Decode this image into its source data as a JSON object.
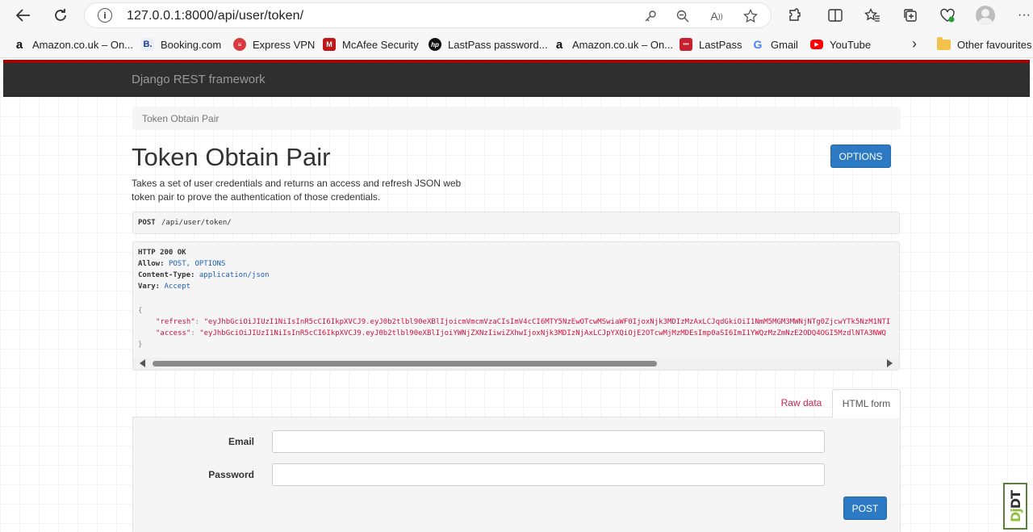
{
  "browser": {
    "url": "127.0.0.1:8000/api/user/token/",
    "bookmarks": [
      {
        "label": "Amazon.co.uk – On...",
        "icon": "amazon-icon"
      },
      {
        "label": "Booking.com",
        "icon": "booking-icon"
      },
      {
        "label": "Express VPN",
        "icon": "expressvpn-icon"
      },
      {
        "label": "McAfee Security",
        "icon": "mcafee-icon"
      },
      {
        "label": "LastPass password...",
        "icon": "hp-icon"
      },
      {
        "label": "Amazon.co.uk – On...",
        "icon": "amazon-icon"
      },
      {
        "label": "LastPass",
        "icon": "lastpass-icon"
      },
      {
        "label": "Gmail",
        "icon": "google-icon"
      },
      {
        "label": "YouTube",
        "icon": "youtube-icon"
      }
    ],
    "other_favourites": "Other favourites"
  },
  "drf": {
    "brand": "Django REST framework",
    "breadcrumb": "Token Obtain Pair",
    "title": "Token Obtain Pair",
    "options_label": "OPTIONS",
    "description_line1": "Takes a set of user credentials and returns an access and refresh JSON web",
    "description_line2": "token pair to prove the authentication of those credentials.",
    "request": {
      "method": "POST",
      "path": "/api/user/token/"
    },
    "response": {
      "status": "HTTP 200 OK",
      "allow_key": "Allow:",
      "allow_value": "POST, OPTIONS",
      "content_type_key": "Content-Type:",
      "content_type_value": "application/json",
      "vary_key": "Vary:",
      "vary_value": "Accept",
      "brace_open": "{",
      "refresh_key": "\"refresh\"",
      "refresh_value": "\"eyJhbGciOiJIUzI1NiIsInR5cCI6IkpXVCJ9.eyJ0b2tlbl90eXBlIjoicmVmcmVzaCIsImV4cCI6MTY5NzEwOTcwMSwiaWF0IjoxNjk3MDIzMzAxLCJqdGkiOiI1NmM5MGM3MWNjNTg0ZjcwYTk5NzM1NTI",
      "access_key": "\"access\"",
      "access_value": "\"eyJhbGciOiJIUzI1NiIsInR5cCI6IkpXVCJ9.eyJ0b2tlbl90eXBlIjoiYWNjZXNzIiwiZXhwIjoxNjk3MDIzNjAxLCJpYXQiOjE2OTcwMjMzMDEsImp0aSI6ImI1YWQzMzZmNzE2ODQ4OGI5MzdlNTA3NWQ",
      "brace_close": "}"
    },
    "tabs": {
      "raw": "Raw data",
      "html": "HTML form"
    },
    "form": {
      "email_label": "Email",
      "email_value": "",
      "password_label": "Password",
      "password_value": "",
      "submit_label": "POST"
    },
    "debug_toolbar": {
      "dj": "Dj",
      "dt": "DT"
    }
  }
}
